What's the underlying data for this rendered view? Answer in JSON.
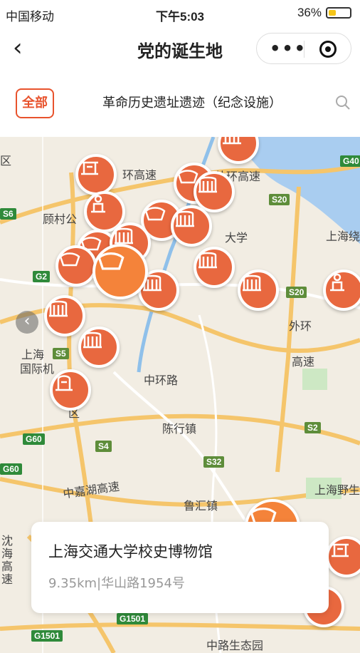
{
  "status_bar": {
    "carrier": "中国移动",
    "time": "下午5:03",
    "battery": "36%",
    "battery_level": 0.36
  },
  "nav": {
    "title": "党的诞生地"
  },
  "filter": {
    "all_label": "全部",
    "category_label": "革命历史遗址遗迹（纪念设施）"
  },
  "map": {
    "labels": [
      {
        "text": "区"
      },
      {
        "text": "环高速"
      },
      {
        "text": "外环高速"
      },
      {
        "text": "顾村公"
      },
      {
        "text": "大学"
      },
      {
        "text": "上海绕"
      },
      {
        "text": "上海"
      },
      {
        "text": "国际机"
      },
      {
        "text": "中环路"
      },
      {
        "text": "外环"
      },
      {
        "text": "高速"
      },
      {
        "text": "陈行镇"
      },
      {
        "text": "中嘉湖高速"
      },
      {
        "text": "鲁汇镇"
      },
      {
        "text": "上海野生"
      },
      {
        "text": "沈海高速"
      },
      {
        "text": "中路生态园"
      },
      {
        "text": "区"
      }
    ],
    "shields": [
      {
        "text": "G40"
      },
      {
        "text": "S20"
      },
      {
        "text": "G2"
      },
      {
        "text": "S20"
      },
      {
        "text": "S5"
      },
      {
        "text": "G60"
      },
      {
        "text": "S4"
      },
      {
        "text": "S32"
      },
      {
        "text": "S2"
      },
      {
        "text": "G60"
      },
      {
        "text": "G1501"
      },
      {
        "text": "G1501"
      },
      {
        "text": "S6"
      }
    ]
  },
  "card": {
    "name": "上海交通大学校史博物馆",
    "address": "9.35km|华山路1954号"
  },
  "colors": {
    "accent": "#e8532d",
    "pin": "#e8683f",
    "pin_selected": "#f4833a"
  }
}
